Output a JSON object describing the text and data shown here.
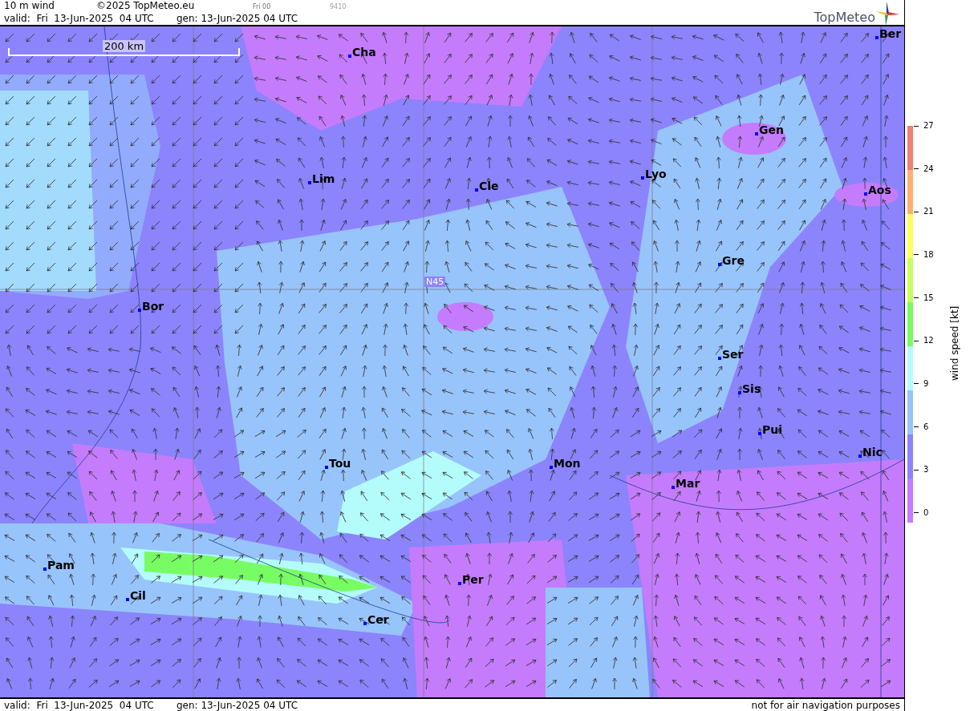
{
  "header": {
    "title": "10 m wind",
    "copyright": "©2025 TopMeteo.eu",
    "run": "Fri 00",
    "code": "9410",
    "valid": "valid:  Fri  13-Jun-2025  04 UTC",
    "gen": "gen: 13-Jun-2025 04 UTC",
    "logo": "TopMeteo"
  },
  "map": {
    "scale_label": "200 km",
    "grid_label": "N45",
    "cities": [
      {
        "name": "Ber"
      },
      {
        "name": "Cha"
      },
      {
        "name": "Gen"
      },
      {
        "name": "Lim"
      },
      {
        "name": "Cle"
      },
      {
        "name": "Lyo"
      },
      {
        "name": "Aos"
      },
      {
        "name": "Gre"
      },
      {
        "name": "Bor"
      },
      {
        "name": "Ser"
      },
      {
        "name": "Sis"
      },
      {
        "name": "Pui"
      },
      {
        "name": "Nic"
      },
      {
        "name": "Tou"
      },
      {
        "name": "Mon"
      },
      {
        "name": "Mar"
      },
      {
        "name": "Pam"
      },
      {
        "name": "Per"
      },
      {
        "name": "Cil"
      },
      {
        "name": "Cer"
      }
    ]
  },
  "legend": {
    "title": "wind speed [kt]",
    "ticks": [
      "27",
      "24",
      "21",
      "18",
      "15",
      "12",
      "9",
      "6",
      "3",
      "0"
    ],
    "bands": [
      {
        "color": "#f08070"
      },
      {
        "color": "#ffb070"
      },
      {
        "color": "#ffff60"
      },
      {
        "color": "#c8ff60"
      },
      {
        "color": "#78fc64"
      },
      {
        "color": "#b4fcfc"
      },
      {
        "color": "#98c4fc"
      },
      {
        "color": "#8c84fc"
      },
      {
        "color": "#c47cfc"
      }
    ]
  },
  "footer": {
    "valid": "valid:  Fri  13-Jun-2025  04 UTC",
    "gen": "gen: 13-Jun-2025 04 UTC",
    "note": "not for air navigation purposes"
  }
}
